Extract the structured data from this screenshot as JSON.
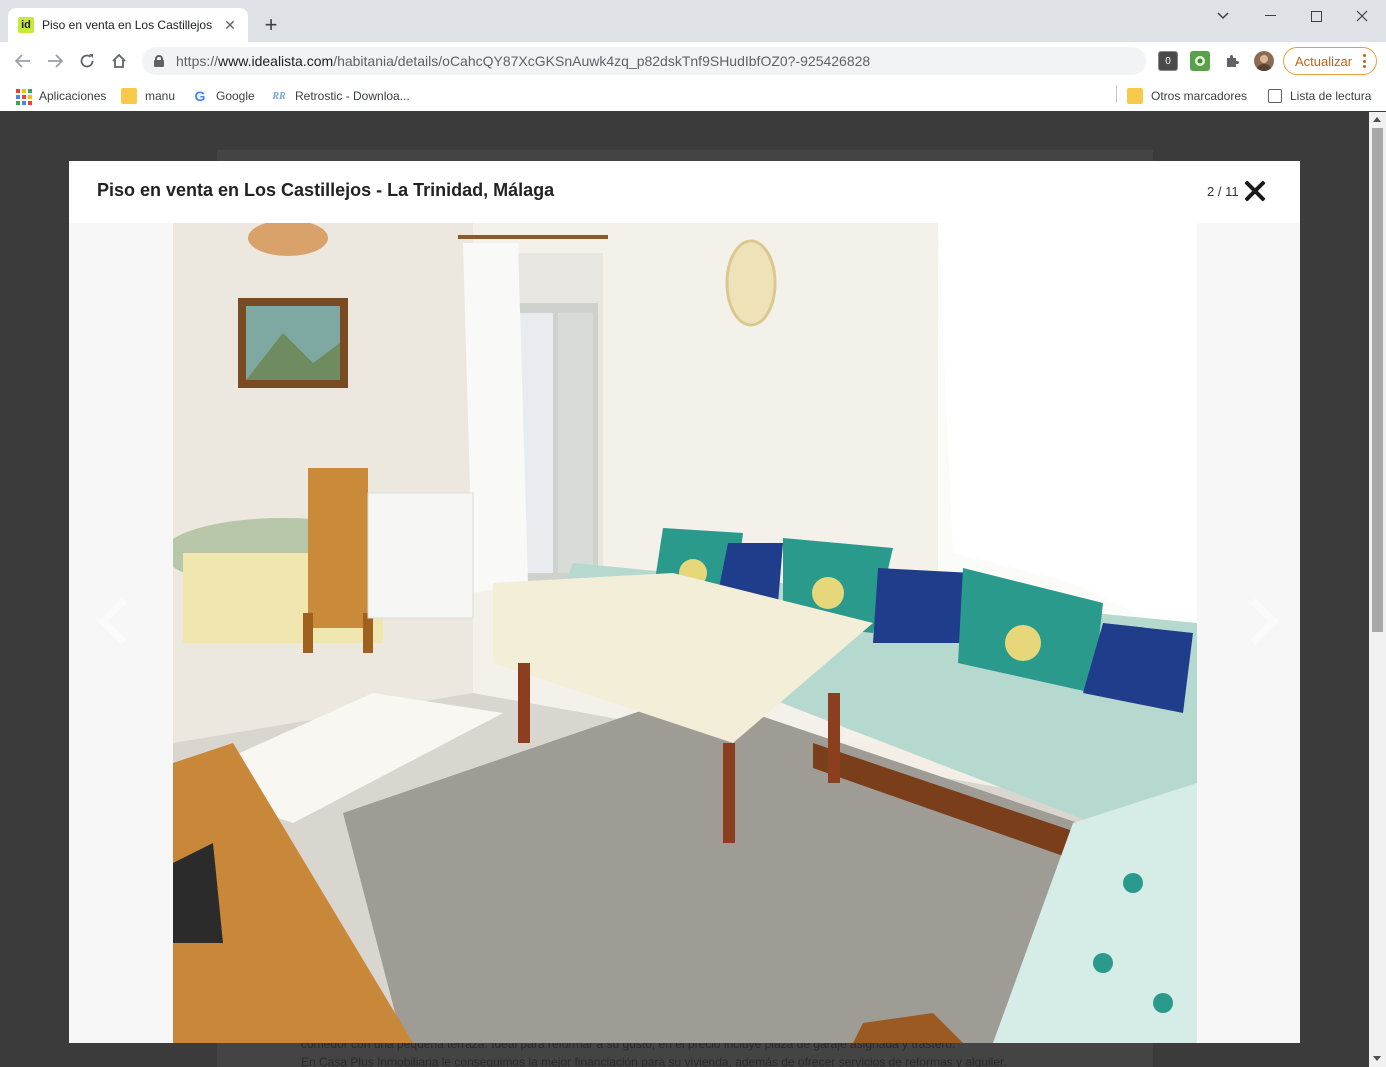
{
  "browser": {
    "tab": {
      "title": "Piso en venta en Los Castillejos -",
      "favicon_text": "id"
    },
    "address": {
      "prefix": "https://",
      "host": "www.idealista.com",
      "path": "/habitania/details/oCahcQY87XcGKSnAuwk4zq_p82dskTnf9SHudIbfOZ0?-925426828"
    },
    "update_button": "Actualizar",
    "bookmarks": [
      {
        "label": "Aplicaciones",
        "icon": "apps-grid-icon"
      },
      {
        "label": "manu",
        "icon": "folder-icon"
      },
      {
        "label": "Google",
        "icon": "google-icon"
      },
      {
        "label": "Retrostic - Downloa...",
        "icon": "retrostic-icon"
      }
    ],
    "other_bookmarks": "Otros marcadores",
    "reading_list": "Lista de lectura"
  },
  "modal": {
    "title": "Piso en venta en Los Castillejos - La Trinidad, Málaga",
    "counter": "2 / 11",
    "photo_alt": "Salón con sofá, mesa y comedor"
  },
  "behind": {
    "line1": "comedor con una pequeña terraza. Ideal para reformar a su gusto, en el precio incluye plaza de garaje asignada y trastero.",
    "line2": "En Casa Plus Inmobiliaria le conseguimos la mejor financiación para su vivienda, además de ofrecer servicios de reformas y alquiler."
  },
  "colors": {
    "overlay": "#3b3b3b",
    "update_accent": "#c0631a",
    "favicon": "#c6e93c"
  }
}
